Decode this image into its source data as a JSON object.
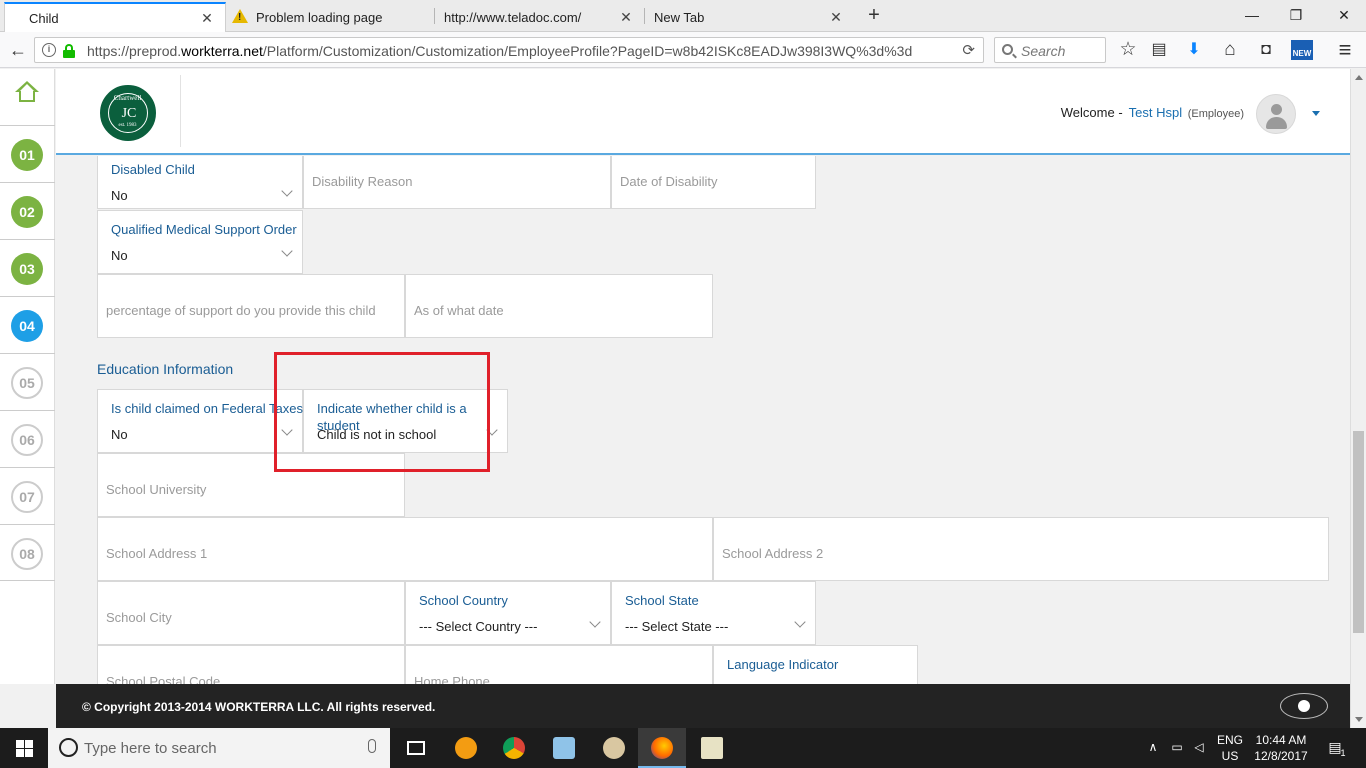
{
  "browser": {
    "tabs": [
      {
        "label": "Child",
        "active": true
      },
      {
        "label": "Problem loading page",
        "icon": "warning-icon"
      },
      {
        "label": "http://www.teladoc.com/"
      },
      {
        "label": "New Tab"
      }
    ],
    "new_tab": "+",
    "window_controls": {
      "minimize": "—",
      "maximize": "❐",
      "close": "✕"
    },
    "url": {
      "scheme": "https://preprod.",
      "domain": "workterra.net",
      "path": "/Platform/Customization/Customization/EmployeeProfile?PageID=w8b42ISKc8EADJw398I3WQ%3d%3d"
    },
    "search_placeholder": "Search",
    "icons": {
      "back": "←",
      "reload": "⟳",
      "bookmark": "☆",
      "reading_list": "▤",
      "download": "⬇",
      "home": "⌂",
      "pocket": "◘",
      "new_badge": "NEW",
      "menu": "≡"
    },
    "accent_color": "#0a84ff"
  },
  "sidebar": {
    "steps": [
      {
        "label": "01",
        "state": "done"
      },
      {
        "label": "02",
        "state": "done"
      },
      {
        "label": "03",
        "state": "done"
      },
      {
        "label": "04",
        "state": "current"
      },
      {
        "label": "05",
        "state": "todo"
      },
      {
        "label": "06",
        "state": "todo"
      },
      {
        "label": "07",
        "state": "todo"
      },
      {
        "label": "08",
        "state": "todo"
      }
    ],
    "done_color": "#7cb342",
    "current_color": "#1e9fe6"
  },
  "header": {
    "logo": {
      "ring_text": "Chartwell",
      "mark": "JC",
      "year": "est. 1983"
    },
    "welcome_prefix": "Welcome -",
    "user_name": "Test Hspl",
    "user_role": "(Employee)"
  },
  "form": {
    "disabled_child": {
      "label": "Disabled Child",
      "value": "No"
    },
    "disability_reason": {
      "placeholder": "Disability Reason"
    },
    "date_of_disability": {
      "placeholder": "Date of Disability"
    },
    "qmso": {
      "label": "Qualified Medical Support Order",
      "value": "No"
    },
    "support_percentage": {
      "placeholder": "percentage of support do you provide this child"
    },
    "as_of_date": {
      "placeholder": "As of what date"
    },
    "education_title": "Education Information",
    "claimed_federal": {
      "label": "Is child claimed on Federal Taxes",
      "value": "No"
    },
    "is_student": {
      "label": "Indicate whether child is a student",
      "value": "Child is not in school"
    },
    "school_university": {
      "placeholder": "School University"
    },
    "school_address1": {
      "placeholder": "School Address 1"
    },
    "school_address2": {
      "placeholder": "School Address 2"
    },
    "school_city": {
      "placeholder": "School City"
    },
    "school_country": {
      "label": "School Country",
      "value": "--- Select Country ---"
    },
    "school_state": {
      "label": "School State",
      "value": "--- Select State ---"
    },
    "school_postal": {
      "placeholder": "School Postal Code"
    },
    "home_phone": {
      "placeholder": "Home Phone"
    },
    "language_indicator": {
      "label": "Language Indicator"
    }
  },
  "footer": {
    "copyright": "© Copyright 2013-2014 WORKTERRA LLC. All rights reserved."
  },
  "taskbar": {
    "search_placeholder": "Type here to search",
    "lang_top": "ENG",
    "lang_bottom": "US",
    "time": "10:44 AM",
    "date": "12/8/2017",
    "notification_count": "1"
  }
}
